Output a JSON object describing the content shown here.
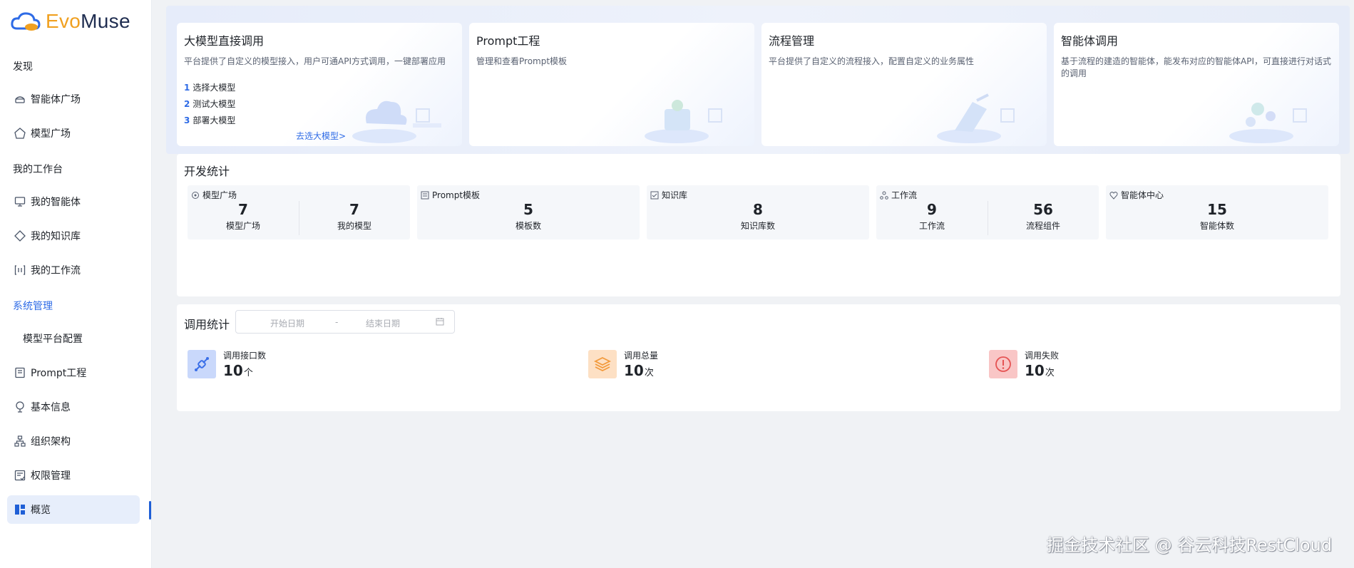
{
  "brand": {
    "evo": "Evo",
    "muse": "Muse",
    "colors": {
      "evo": "#f0a020",
      "muse": "#1f2d50",
      "mark": "#2e6be6"
    }
  },
  "sidebar": {
    "group_discover": "发现",
    "item_agent_plaza": "智能体广场",
    "item_model_plaza": "模型广场",
    "group_workbench": "我的工作台",
    "item_my_agents": "我的智能体",
    "item_my_knowledge": "我的知识库",
    "item_my_workflow": "我的工作流",
    "group_system": "系统管理",
    "item_model_config": "模型平台配置",
    "item_prompt": "Prompt工程",
    "item_basic_info": "基本信息",
    "item_org": "组织架构",
    "item_permission": "权限管理",
    "item_overview": "概览",
    "icons": [
      "agent-plaza-icon",
      "model-plaza-icon",
      "my-agents-icon",
      "knowledge-icon",
      "workflow-icon",
      "prompt-icon",
      "basic-info-icon",
      "org-icon",
      "permission-icon",
      "overview-icon"
    ]
  },
  "cards": [
    {
      "title": "大模型直接调用",
      "desc": "平台提供了自定义的模型接入，用户可通API方式调用，一键部署应用",
      "steps": [
        {
          "num": "1",
          "text": "选择大模型"
        },
        {
          "num": "2",
          "text": "测试大模型"
        },
        {
          "num": "3",
          "text": "部署大模型"
        }
      ],
      "link": "去选大模型>"
    },
    {
      "title": "Prompt工程",
      "desc": "管理和查看Prompt模板"
    },
    {
      "title": "流程管理",
      "desc": "平台提供了自定义的流程接入，配置自定义的业务属性"
    },
    {
      "title": "智能体调用",
      "desc": "基于流程的建造的智能体，能发布对应的智能体API，可直接进行对话式的调用"
    }
  ],
  "dev_stats": {
    "title": "开发统计",
    "boxes": [
      {
        "head": "模型广场",
        "icon": "model-plaza-icon",
        "cols": [
          {
            "value": "7",
            "label": "模型广场"
          },
          {
            "value": "7",
            "label": "我的模型"
          }
        ]
      },
      {
        "head": "Prompt模板",
        "icon": "prompt-template-icon",
        "cols": [
          {
            "value": "5",
            "label": "模板数"
          }
        ]
      },
      {
        "head": "知识库",
        "icon": "knowledge-icon",
        "cols": [
          {
            "value": "8",
            "label": "知识库数"
          }
        ]
      },
      {
        "head": "工作流",
        "icon": "workflow-icon",
        "cols": [
          {
            "value": "9",
            "label": "工作流"
          },
          {
            "value": "56",
            "label": "流程组件"
          }
        ]
      },
      {
        "head": "智能体中心",
        "icon": "agent-center-icon",
        "cols": [
          {
            "value": "15",
            "label": "智能体数"
          }
        ]
      }
    ]
  },
  "call_stats": {
    "title": "调用统计",
    "start_placeholder": "开始日期",
    "separator": "-",
    "end_placeholder": "结束日期",
    "items": [
      {
        "label": "调用接口数",
        "value": "10",
        "unit": "个",
        "icon": "interface-link-icon",
        "bg": "#c9d8fb",
        "fg": "#3a6fe8"
      },
      {
        "label": "调用总量",
        "value": "10",
        "unit": "次",
        "icon": "layers-icon",
        "bg": "#fde0c4",
        "fg": "#f29a3c"
      },
      {
        "label": "调用失败",
        "value": "10",
        "unit": "次",
        "icon": "alert-icon",
        "bg": "#f9c6c6",
        "fg": "#e55353"
      }
    ]
  },
  "watermark": "掘金技术社区 @ 谷云科技RestCloud"
}
